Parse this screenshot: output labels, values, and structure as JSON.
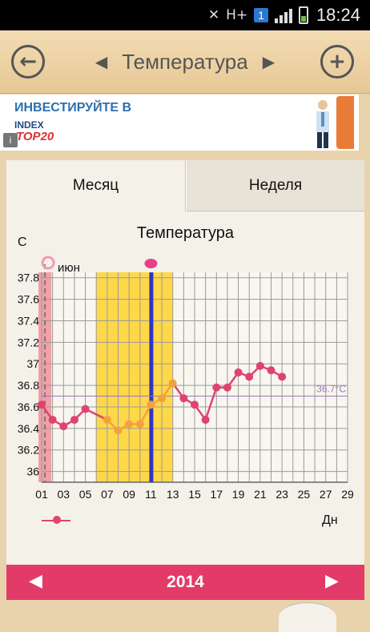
{
  "status_bar": {
    "network": "H+",
    "notification_badge": "1",
    "time": "18:24"
  },
  "header": {
    "title": "Температура",
    "back_icon": "back-arrow-icon",
    "add_icon": "plus-icon"
  },
  "ad": {
    "headline": "ИНВЕСТИРУЙТЕ В",
    "brand_index": "INDEX",
    "brand_top": "TOP20",
    "info": "i"
  },
  "tabs": {
    "month": "Месяц",
    "week": "Неделя"
  },
  "chart_data": {
    "type": "line",
    "title": "Температура",
    "ylabel": "С",
    "xlabel": "Дн",
    "month_label": "июн",
    "ylim": [
      35.9,
      37.85
    ],
    "y_ticks": [
      "37.8",
      "37.6",
      "37.4",
      "37.2",
      "37",
      "36.8",
      "36.6",
      "36.4",
      "36.2",
      "36"
    ],
    "y_tick_values": [
      37.8,
      37.6,
      37.4,
      37.2,
      37.0,
      36.8,
      36.6,
      36.4,
      36.2,
      36.0
    ],
    "x_range": [
      1,
      29
    ],
    "x_ticks": [
      "01",
      "03",
      "05",
      "07",
      "09",
      "11",
      "13",
      "15",
      "17",
      "19",
      "21",
      "23",
      "25",
      "27",
      "29"
    ],
    "x": [
      1,
      2,
      3,
      4,
      5,
      7,
      8,
      9,
      10,
      11,
      12,
      13,
      14,
      15,
      16,
      17,
      18,
      19,
      20,
      21,
      22,
      23
    ],
    "y": [
      36.62,
      36.48,
      36.42,
      36.48,
      36.58,
      36.48,
      36.38,
      36.44,
      36.44,
      36.62,
      36.68,
      36.82,
      36.68,
      36.62,
      36.48,
      36.78,
      36.78,
      36.92,
      36.88,
      36.98,
      36.94,
      36.88
    ],
    "orange_segment_days": [
      7,
      8,
      9,
      10,
      11,
      12,
      13
    ],
    "coverline": {
      "value": 36.7,
      "label": "36.7°C"
    },
    "period_days": [
      1,
      1.9
    ],
    "fertile_window": [
      6,
      13
    ],
    "ovulation_day": 11,
    "today_day": 1.3,
    "colors": {
      "series": "#e0436f",
      "fertile": "#ffd84a",
      "ovulation": "#3334c0",
      "period": "#f0a0a8",
      "coverline": "#9a77c0",
      "orange": "#f2a23c"
    }
  },
  "legend": {
    "series_label": ""
  },
  "footer": {
    "year": "2014",
    "prev_icon": "prev-triangle-icon",
    "next_icon": "next-triangle-icon"
  }
}
